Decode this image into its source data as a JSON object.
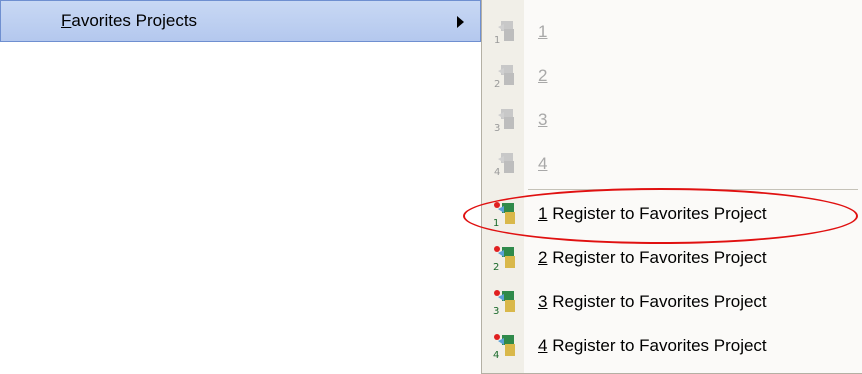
{
  "parent_menu": {
    "mnemonic": "F",
    "label_rest": "avorites Projects"
  },
  "submenu": {
    "open_items": [
      {
        "number": "1",
        "label": ""
      },
      {
        "number": "2",
        "label": ""
      },
      {
        "number": "3",
        "label": ""
      },
      {
        "number": "4",
        "label": ""
      }
    ],
    "register_items": [
      {
        "number": "1",
        "label": " Register to Favorites Project"
      },
      {
        "number": "2",
        "label": " Register to Favorites Project"
      },
      {
        "number": "3",
        "label": " Register to Favorites Project"
      },
      {
        "number": "4",
        "label": " Register to Favorites Project"
      }
    ]
  },
  "colors": {
    "highlight_ring": "#e01010",
    "parent_highlight": "#b4c8ee"
  },
  "icons": {
    "open_item": "favorite-project-icon",
    "register_item": "register-favorite-project-icon"
  }
}
